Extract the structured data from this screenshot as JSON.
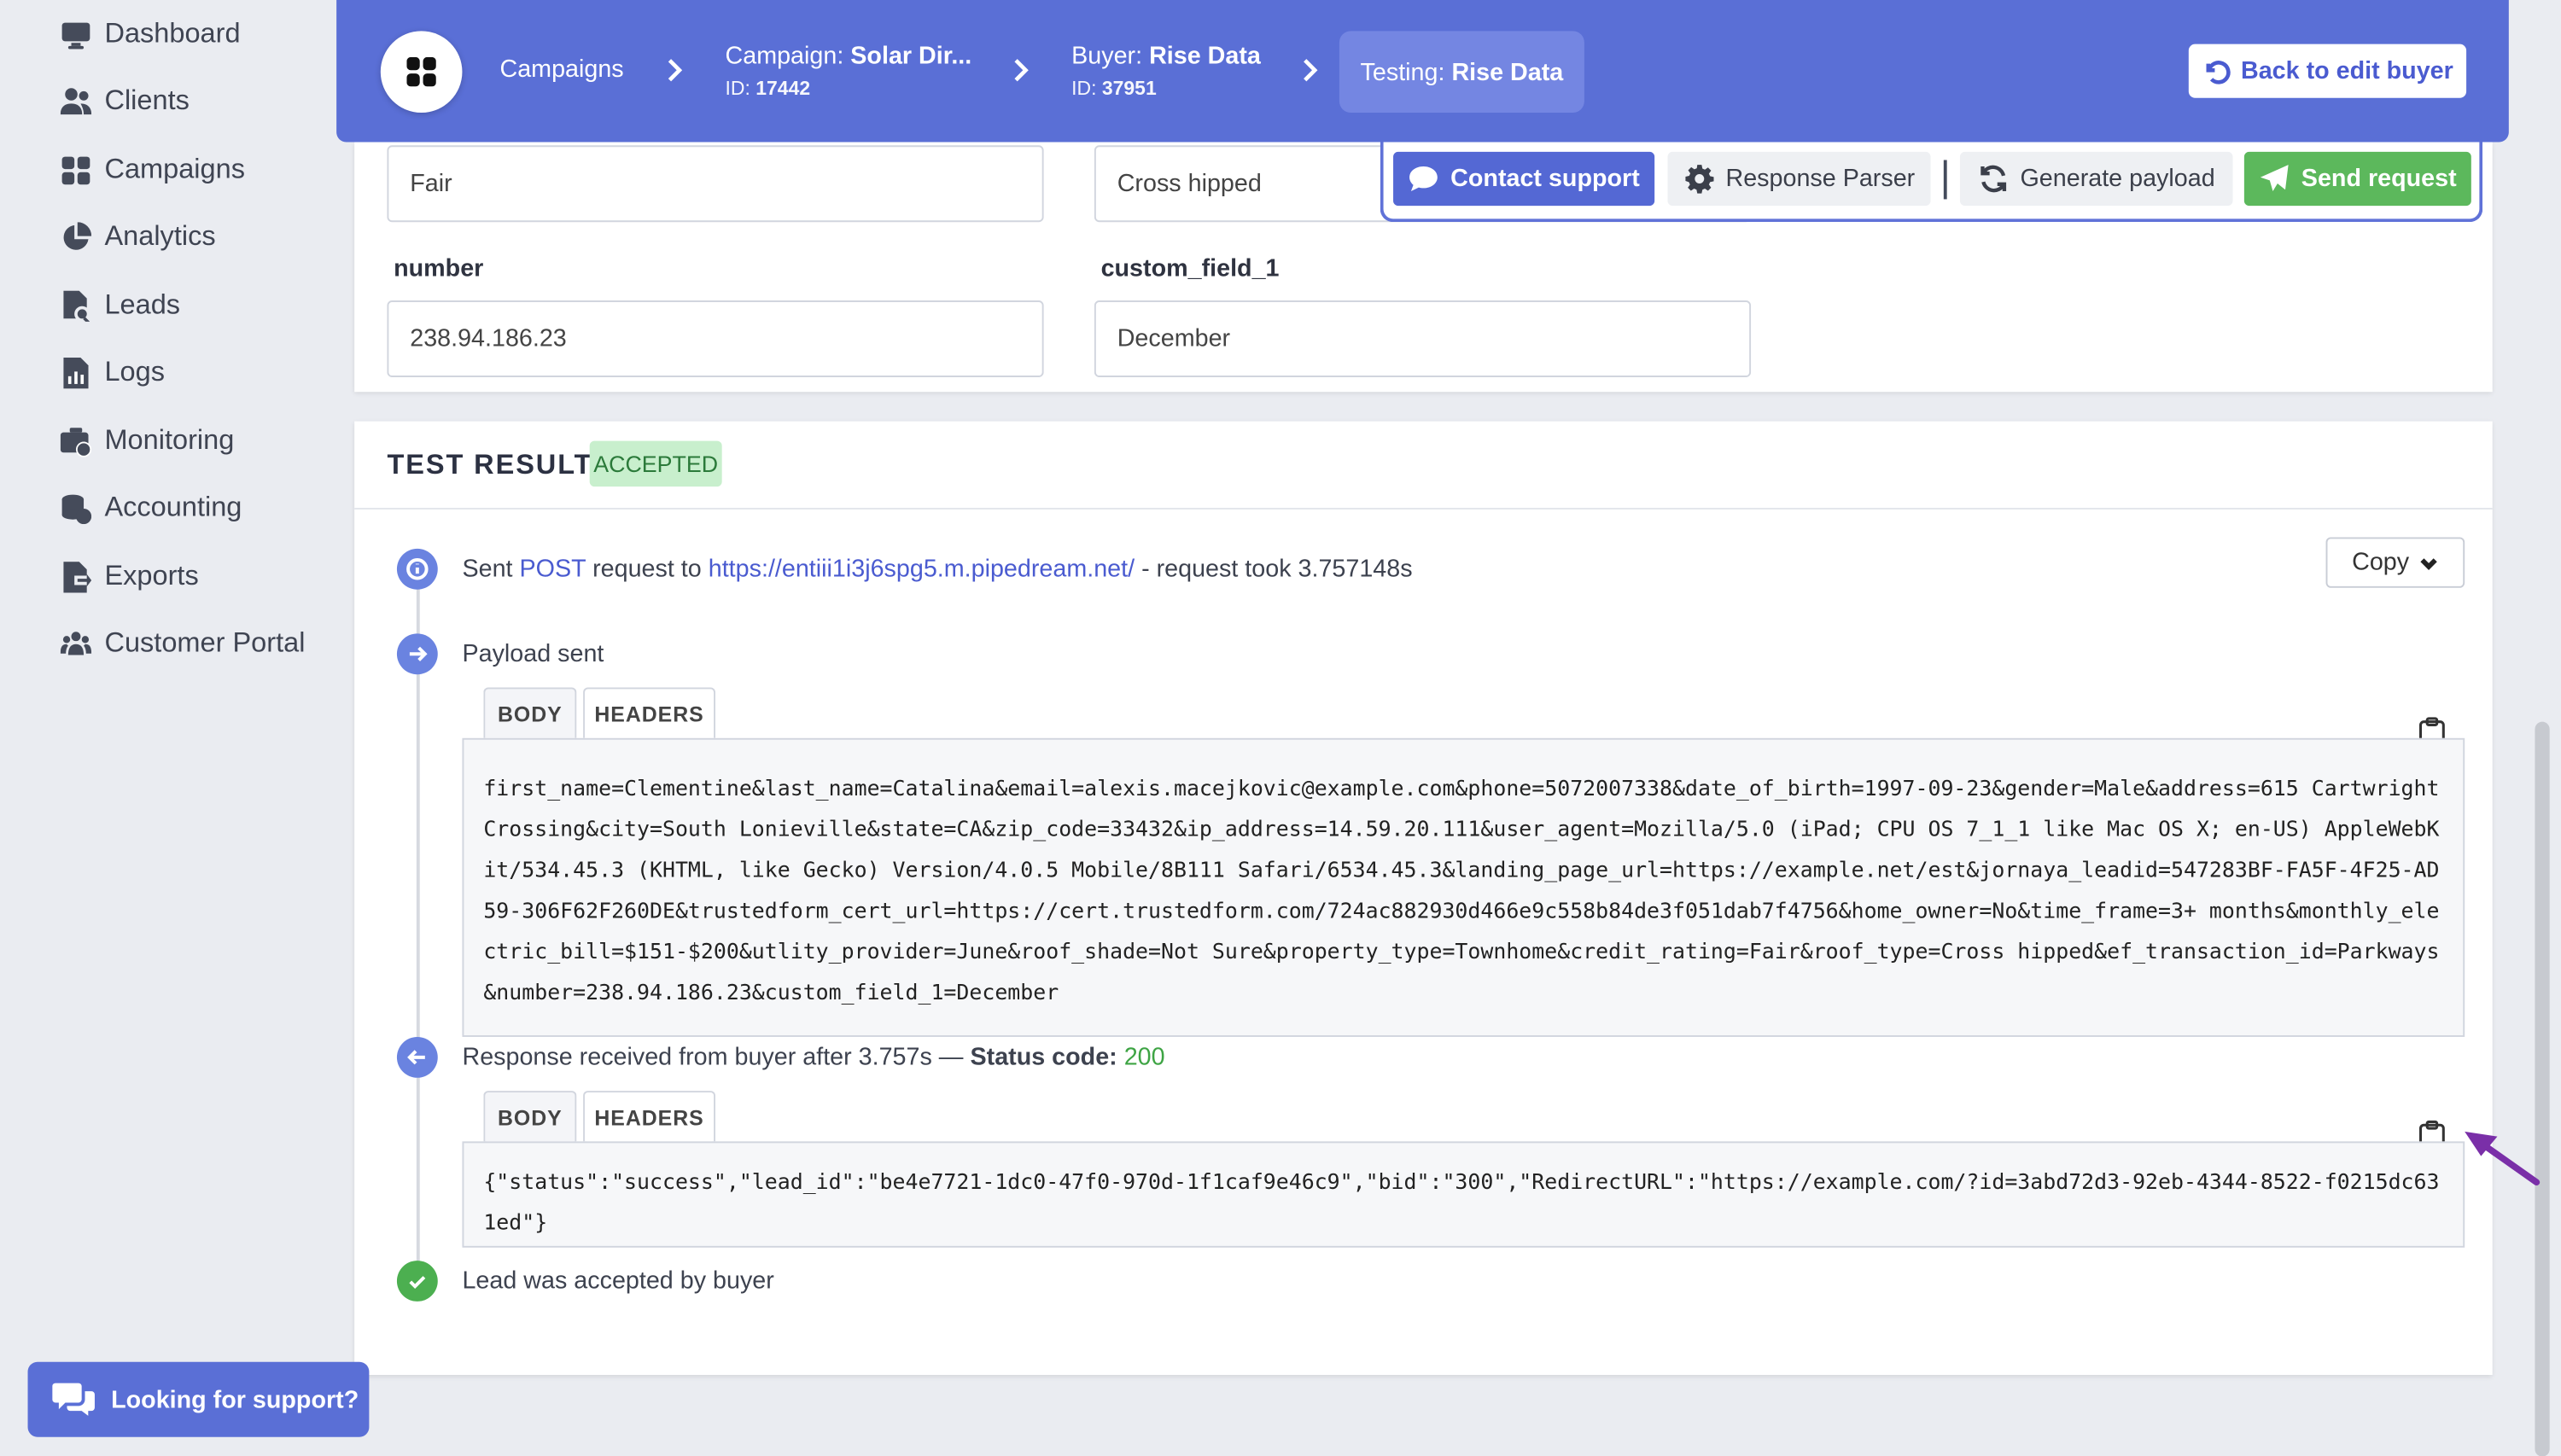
{
  "sidebar": {
    "items": [
      {
        "label": "Dashboard",
        "icon": "monitor-icon"
      },
      {
        "label": "Clients",
        "icon": "users-icon"
      },
      {
        "label": "Campaigns",
        "icon": "grid-icon"
      },
      {
        "label": "Analytics",
        "icon": "pie-chart-icon"
      },
      {
        "label": "Leads",
        "icon": "file-search-icon"
      },
      {
        "label": "Logs",
        "icon": "file-chart-icon"
      },
      {
        "label": "Monitoring",
        "icon": "briefcase-clock-icon"
      },
      {
        "label": "Accounting",
        "icon": "coins-icon"
      },
      {
        "label": "Exports",
        "icon": "file-export-icon"
      },
      {
        "label": "Customer Portal",
        "icon": "team-icon"
      }
    ]
  },
  "header": {
    "crumb_campaigns": "Campaigns",
    "crumb_campaign_prefix": "Campaign:",
    "crumb_campaign_name": "Solar Dir...",
    "crumb_campaign_id_label": "ID:",
    "crumb_campaign_id": "17442",
    "crumb_buyer_prefix": "Buyer:",
    "crumb_buyer_name": "Rise Data",
    "crumb_buyer_id_label": "ID:",
    "crumb_buyer_id": "37951",
    "crumb_testing_prefix": "Testing:",
    "crumb_testing_name": "Rise Data",
    "back_button": "Back to edit buyer"
  },
  "form": {
    "credit_rating_value": "Fair",
    "roof_type_value": "Cross hipped",
    "number_label": "number",
    "number_value": "238.94.186.23",
    "custom_field_label": "custom_field_1",
    "custom_field_value": "December"
  },
  "toolbar": {
    "contact_support": "Contact support",
    "response_parser": "Response Parser",
    "generate_payload": "Generate payload",
    "send_request": "Send request"
  },
  "result": {
    "title": "TEST RESULT",
    "status": "ACCEPTED",
    "sent_prefix": "Sent",
    "method": "POST",
    "request_to": "request to",
    "url": "https://entiii1i3j6spg5.m.pipedream.net/",
    "took_text": "- request took 3.757148s",
    "copy_button": "Copy",
    "payload_sent": "Payload sent",
    "tab_body": "BODY",
    "tab_headers": "HEADERS",
    "payload_body": "first_name=Clementine&last_name=Catalina&email=alexis.macejkovic@example.com&phone=5072007338&date_of_birth=1997-09-23&gender=Male&address=615 Cartwright Crossing&city=South Lonieville&state=CA&zip_code=33432&ip_address=14.59.20.111&user_agent=Mozilla/5.0 (iPad; CPU OS 7_1_1 like Mac OS X; en-US) AppleWebKit/534.45.3 (KHTML, like Gecko) Version/4.0.5 Mobile/8B111 Safari/6534.45.3&landing_page_url=https://example.net/est&jornaya_leadid=547283BF-FA5F-4F25-AD59-306F62F260DE&trustedform_cert_url=https://cert.trustedform.com/724ac882930d466e9c558b84de3f051dab7f4756&home_owner=No&time_frame=3+ months&monthly_electric_bill=$151-$200&utlity_provider=June&roof_shade=Not Sure&property_type=Townhome&credit_rating=Fair&roof_type=Cross hipped&ef_transaction_id=Parkways&number=238.94.186.23&custom_field_1=December",
    "response_prefix": "Response received from buyer after 3.757s —",
    "status_code_label": "Status code:",
    "status_code": "200",
    "response_body": "{\"status\":\"success\",\"lead_id\":\"be4e7721-1dc0-47f0-970d-1f1caf9e46c9\",\"bid\":\"300\",\"RedirectURL\":\"https://example.com/?id=3abd72d3-92eb-4344-8522-f0215dc631ed\"}",
    "accepted_text": "Lead was accepted by buyer"
  },
  "support_bubble": "Looking for support?",
  "colors": {
    "brand": "#5a6fd6",
    "success": "#5cb85c",
    "accepted_badge_bg": "#c8efcd",
    "annotation_arrow": "#7a2fa8"
  }
}
